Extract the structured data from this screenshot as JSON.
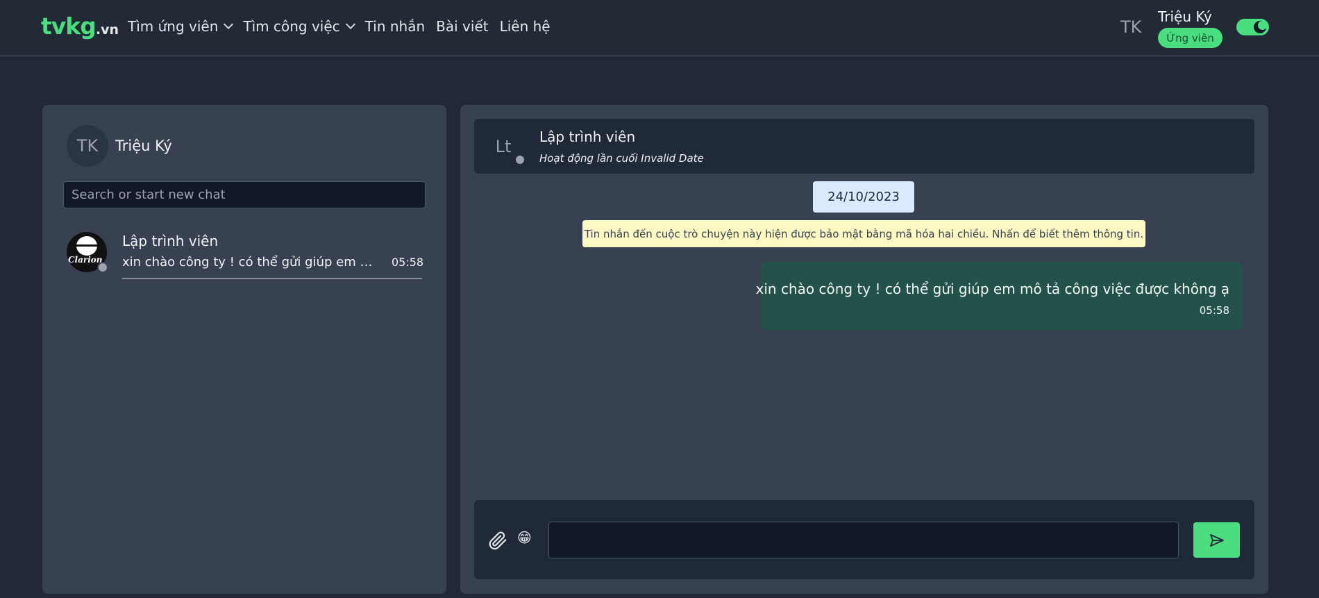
{
  "header": {
    "logo_main": "tvkg",
    "logo_tld": ".vn",
    "nav": [
      {
        "label": "Tìm ứng viên",
        "dropdown": true
      },
      {
        "label": "Tìm công việc",
        "dropdown": true
      },
      {
        "label": "Tin nhắn",
        "dropdown": false
      },
      {
        "label": "Bài viết",
        "dropdown": false
      },
      {
        "label": "Liên hệ",
        "dropdown": false
      }
    ],
    "user_initials": "TK",
    "user_name": "Triệu Ký",
    "user_role": "Ứng viên",
    "theme_toggle_icon": "moon-icon"
  },
  "sidebar": {
    "me_initials": "TK",
    "me_name": "Triệu Ký",
    "search_placeholder": "Search or start new chat",
    "conversations": [
      {
        "name": "Lập trình viên",
        "avatar_logo_text": "Clarion",
        "last_message": "xin chào công ty ! có thể gửi giúp em mô tả công việc được không ạ",
        "time": "05:58"
      }
    ]
  },
  "chat": {
    "peer_initials": "Lt",
    "peer_name": "Lập trình viên",
    "peer_status": "Hoạt động lần cuối Invalid Date",
    "date_chip": "24/10/2023",
    "encryption_notice": "Tin nhắn đến cuộc trò chuyện này hiện được bảo mật bằng mã hóa hai chiều. Nhấn để biết thêm thông tin.",
    "messages": [
      {
        "text": "xin chào công ty ! có thể gửi giúp em mô tả công việc được không ạ",
        "time": "05:58",
        "outgoing": true
      }
    ],
    "composer": {
      "attach_icon": "paperclip-icon",
      "emoji": "😁",
      "input_value": "",
      "send_icon": "send-icon"
    }
  },
  "colors": {
    "accent": "#4ade80",
    "background": "#212936",
    "panel": "#374151",
    "outgoing_bubble": "#22524a",
    "notice": "#fef9c3"
  }
}
